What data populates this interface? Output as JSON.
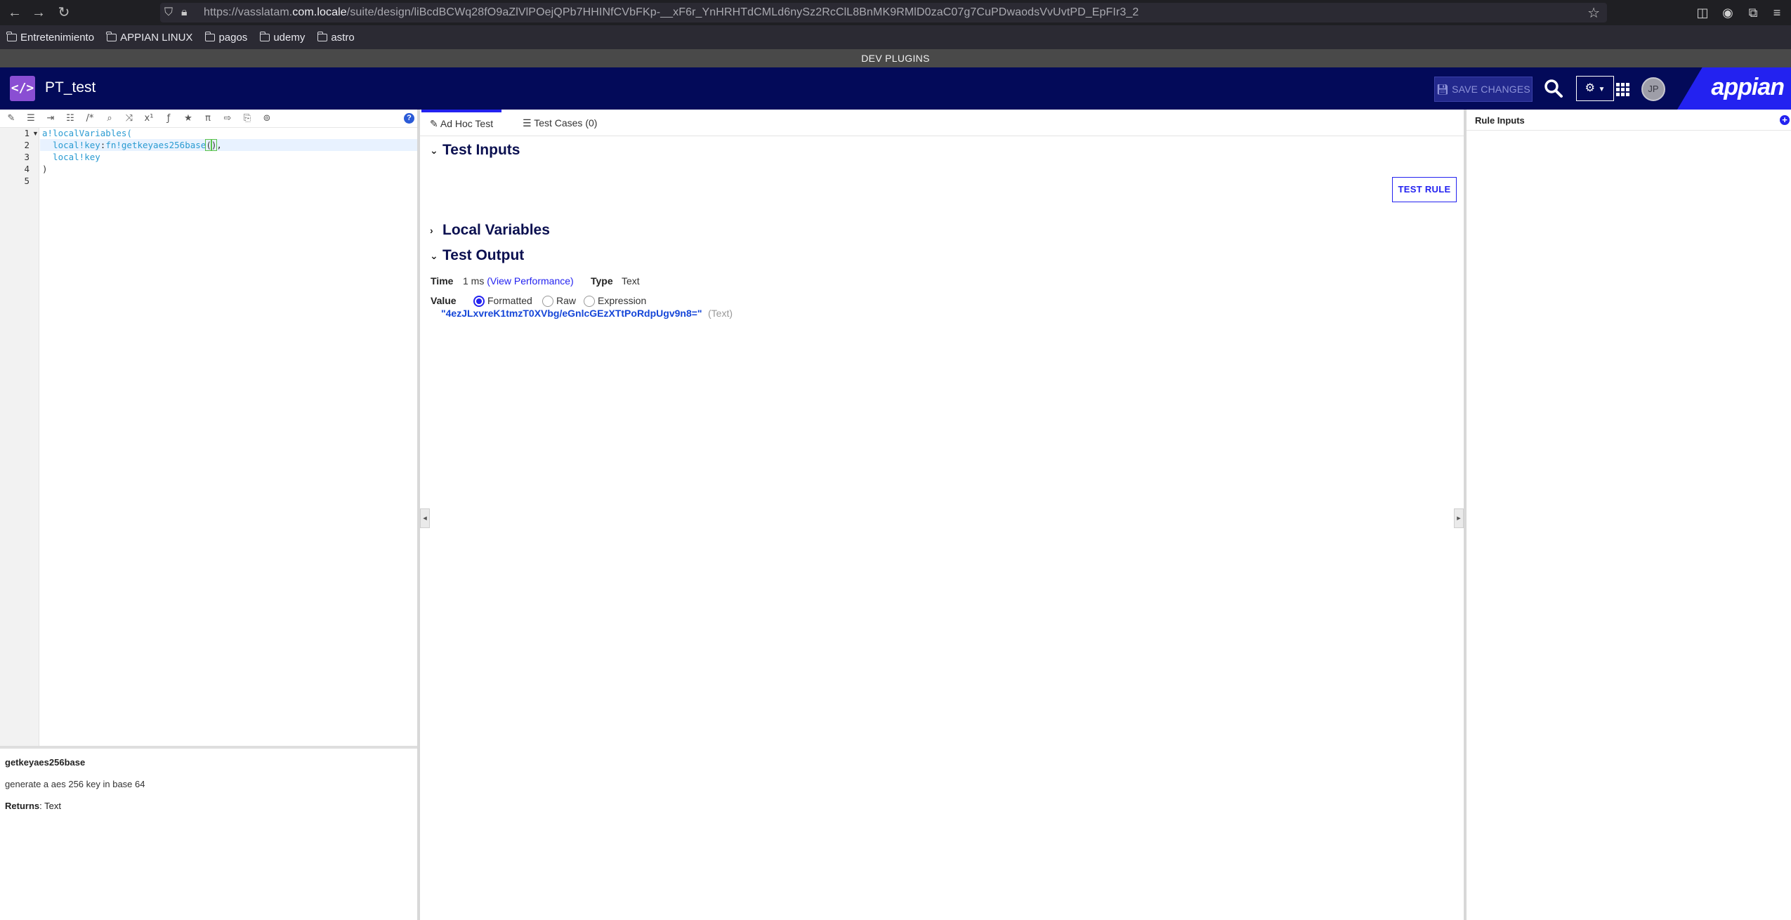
{
  "browser": {
    "url_prefix": "https://vasslatam.",
    "url_domain": "com.locale",
    "url_path": "/suite/design/liBcdBCWq28fO9aZlVlPOejQPb7HHINfCVbFKp-__xF6r_YnHRHTdCMLd6nySz2RcClL8BnMK9RMlD0zaC07g7CuPDwaodsVvUvtPD_EpFIr3_2",
    "bookmarks": [
      "Entretenimiento",
      "APPIAN LINUX",
      "pagos",
      "udemy",
      "astro"
    ]
  },
  "banner": {
    "text": "DEV PLUGINS"
  },
  "header": {
    "object_title": "PT_test",
    "save_label": "SAVE CHANGES",
    "avatar_initials": "JP",
    "brand": "appian"
  },
  "editor": {
    "line_numbers": [
      "1",
      "2",
      "3",
      "4",
      "5"
    ],
    "lines": {
      "l1": "a!localVariables(",
      "l2_var": "  local!key",
      "l2_colon": ":",
      "l2_fn": "fn!getkeyaes256base",
      "l2_paren_open": "(",
      "l2_paren_close": ")",
      "l2_comma": ",",
      "l3": "  local!key",
      "l4": ")"
    }
  },
  "docs": {
    "function_name": "getkeyaes256base",
    "description": "generate a aes 256 key in base 64",
    "returns_label": "Returns",
    "returns_value": ": Text"
  },
  "tabs": {
    "adhoc": "Ad Hoc Test",
    "cases": "Test Cases (0)"
  },
  "sections": {
    "inputs": "Test Inputs",
    "locals": "Local Variables",
    "output": "Test Output"
  },
  "test_rule_label": "TEST RULE",
  "output": {
    "time_label": "Time",
    "time_value": "1 ms",
    "view_performance": "(View Performance)",
    "type_label": "Type",
    "type_value": "Text",
    "value_label": "Value",
    "radio_options": [
      "Formatted",
      "Raw",
      "Expression"
    ],
    "selected": "Formatted",
    "result": "\"4ezJLxvreK1tmzT0XVbg/eGnlcGEzXTtPoRdpUgv9n8=\"",
    "result_type": "(Text)"
  },
  "right_panel": {
    "title": "Rule Inputs"
  }
}
